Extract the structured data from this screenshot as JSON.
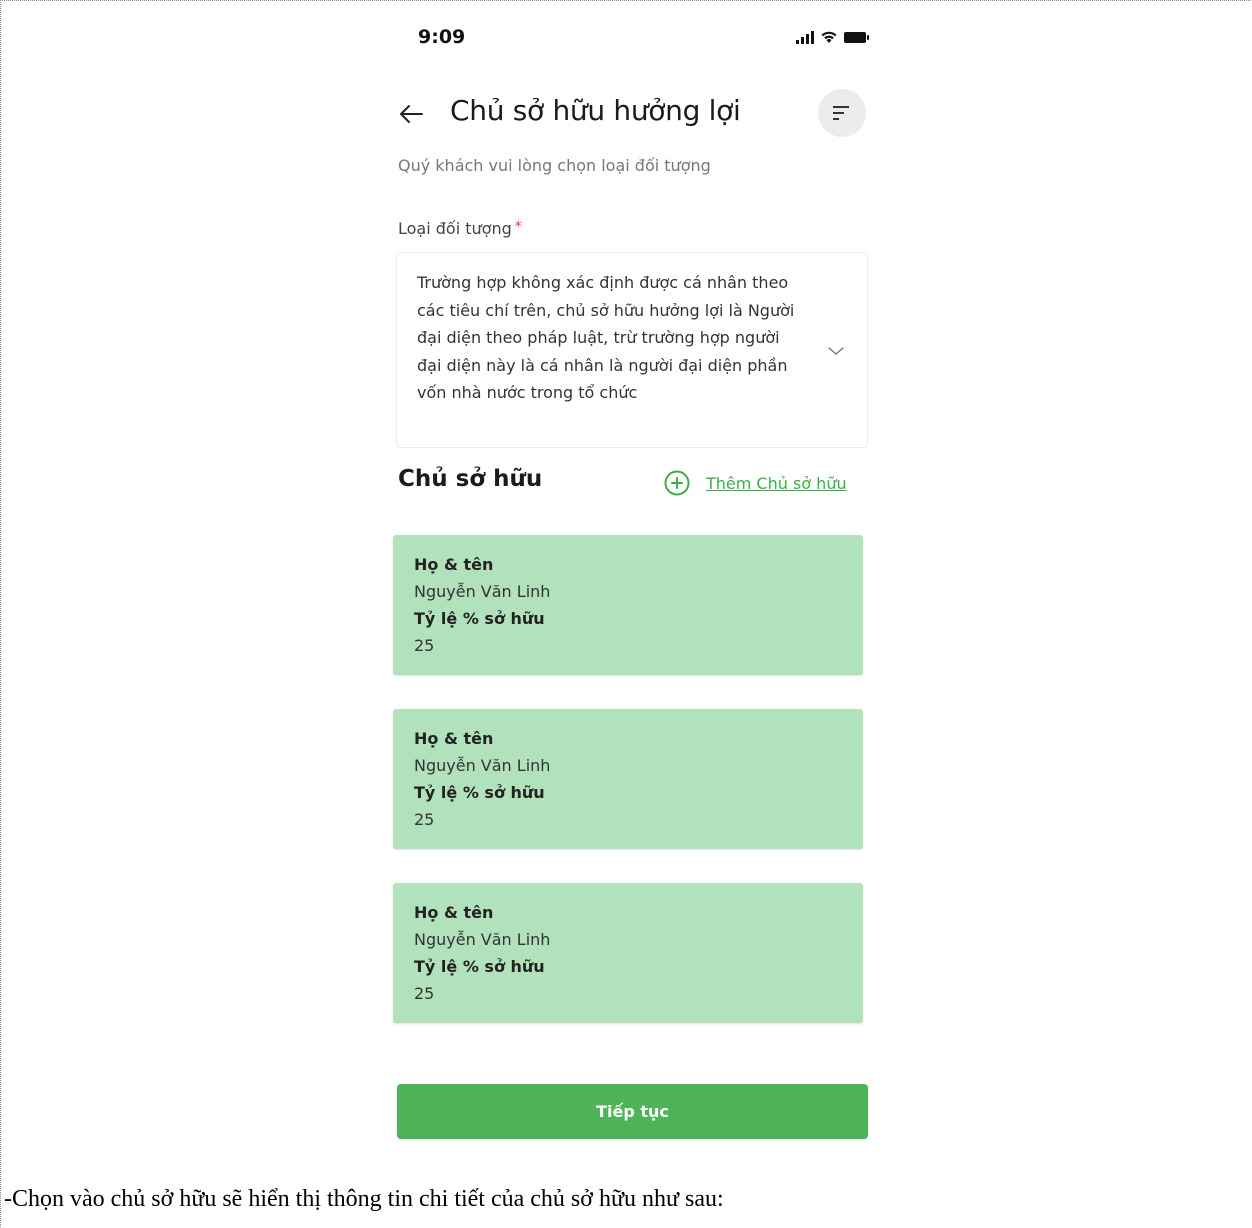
{
  "status_bar": {
    "time": "9:09",
    "icons": [
      "signal-icon",
      "wifi-icon",
      "battery-icon"
    ]
  },
  "header": {
    "title": "Chủ sở hữu hưởng lợi",
    "back_icon": "arrow-left-icon",
    "filter_icon": "filter-icon"
  },
  "subtitle": "Quý khách vui lòng chọn loại đối tượng",
  "object_type": {
    "label": "Loại đối tượng",
    "required_mark": "*",
    "selected_value": "Trường hợp không xác định được cá nhân theo các tiêu chí trên, chủ sở hữu hưởng lợi là Người đại diện theo pháp luật, trừ trường hợp người đại diện này là cá nhân là người đại diện phần vốn nhà nước trong tổ chức"
  },
  "owners_section": {
    "title": "Chủ sở hữu",
    "add_label": "Thêm Chủ sở hữu",
    "owners": [
      {
        "name_label": "Họ & tên",
        "name": "Nguyễn Văn Linh",
        "ratio_label": "Tỷ lệ % sở hữu",
        "ratio": "25"
      },
      {
        "name_label": "Họ & tên",
        "name": "Nguyễn Văn Linh",
        "ratio_label": "Tỷ lệ % sở hữu",
        "ratio": "25"
      },
      {
        "name_label": "Họ & tên",
        "name": "Nguyễn Văn Linh",
        "ratio_label": "Tỷ lệ % sở hữu",
        "ratio": "25"
      }
    ]
  },
  "continue_label": "Tiếp tục",
  "caption": "-Chọn vào chủ sở hữu sẽ hiển thị thông tin chi tiết của chủ sở hữu như sau:",
  "colors": {
    "accent": "#4fb35a",
    "card_background": "#b1e2bc",
    "link": "#3fae4a",
    "required": "#e53935"
  }
}
